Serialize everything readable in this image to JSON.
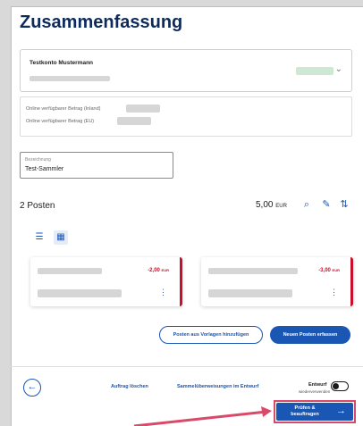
{
  "page": {
    "title": "Zusammenfassung"
  },
  "account": {
    "name": "Testkonto Mustermann",
    "chevron_icon": "chevron-down-icon"
  },
  "info": {
    "line_inland": "Online verfügbarer Betrag (Inland)",
    "line_eu": "Online verfügbarer Betrag (EU)"
  },
  "description": {
    "label": "Bezeichnung",
    "value": "Test-Sammler"
  },
  "posten": {
    "count_label": "2 Posten",
    "sum": "5,00",
    "currency": "EUR",
    "icons": [
      "search-icon",
      "pencil-icon",
      "sort-icon"
    ]
  },
  "cards": [
    {
      "amount": "-2,00",
      "currency": "EUR"
    },
    {
      "amount": "-3,00",
      "currency": "EUR"
    }
  ],
  "actions": {
    "from_templates": "Posten aus Vorlagen hinzufügen",
    "new_posten": "Neuen Posten erfassen"
  },
  "footer": {
    "delete": "Auftrag löschen",
    "drafts": "Sammelüberweisungen im Entwurf",
    "draft_label": "Entwurf",
    "draft_sub": "wiederverwenden",
    "submit": "Prüfen & beauftragen"
  },
  "colors": {
    "accent": "#1a56b3",
    "title": "#0d2b5c",
    "negative": "#c8102e",
    "highlight": "#d94a6a"
  }
}
